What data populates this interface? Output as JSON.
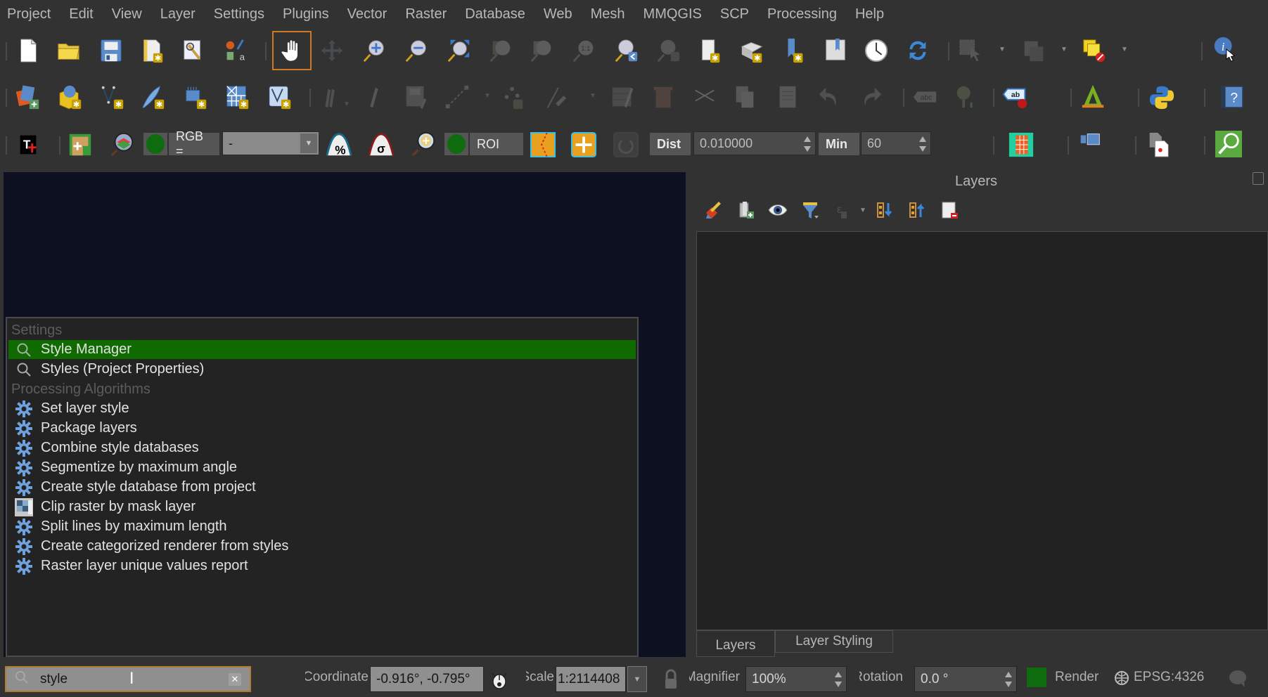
{
  "menubar": {
    "items": [
      "Project",
      "Edit",
      "View",
      "Layer",
      "Settings",
      "Plugins",
      "Vector",
      "Raster",
      "Database",
      "Web",
      "Mesh",
      "MMQGIS",
      "SCP",
      "Processing",
      "Help"
    ]
  },
  "toolbars": {
    "row1": [
      "new-project",
      "open-project",
      "save-project",
      "new-print-layout",
      "style-manager",
      "style-manager-symbols",
      "pan-map",
      "pan-to-selection",
      "zoom-in",
      "zoom-out",
      "zoom-full",
      "zoom-to-selection",
      "zoom-to-layer",
      "zoom-native",
      "zoom-last",
      "zoom-next",
      "new-map-view",
      "new-3d-map-view",
      "new-spatial-bookmark",
      "show-bookmarks",
      "temporal-controller",
      "refresh",
      "select-features",
      "open-attribute-table",
      "deselect-all",
      "identify-features"
    ],
    "row2": [
      "data-source-manager",
      "new-geopackage-layer",
      "new-shapefile-layer",
      "new-temporary-scratch-layer",
      "new-virtual-layer",
      "new-mesh-layer",
      "new-gpx-layer",
      "current-edits",
      "toggle-editing",
      "save-layer-edits",
      "digitize",
      "add-ring",
      "vertex-tool",
      "modify-attributes",
      "delete-selected",
      "cut-features",
      "copy-features",
      "paste-features",
      "undo",
      "redo",
      "label-toolbar",
      "diagram",
      "label-tool",
      "georeferencer",
      "python-console",
      "help"
    ]
  },
  "scp_toolbar": {
    "rgb_label": "RGB =",
    "rgb_value": "-",
    "roi_label": "ROI",
    "dist_label": "Dist",
    "dist_value": "0.010000",
    "min_label": "Min",
    "min_value": "60"
  },
  "locator": {
    "groups": [
      {
        "title": "Settings",
        "items": [
          {
            "label": "Style Manager",
            "icon": "search-icon",
            "selected": true
          },
          {
            "label": "Styles (Project Properties)",
            "icon": "search-icon",
            "selected": false
          }
        ]
      },
      {
        "title": "Processing Algorithms",
        "items": [
          {
            "label": "Set layer style",
            "icon": "gear-icon"
          },
          {
            "label": "Package layers",
            "icon": "gear-icon"
          },
          {
            "label": "Combine style databases",
            "icon": "gear-icon"
          },
          {
            "label": "Segmentize by maximum angle",
            "icon": "gear-icon"
          },
          {
            "label": "Create style database from project",
            "icon": "gear-icon"
          },
          {
            "label": "Clip raster by mask layer",
            "icon": "raster-clip-icon"
          },
          {
            "label": "Split lines by maximum length",
            "icon": "gear-icon"
          },
          {
            "label": "Create categorized renderer from styles",
            "icon": "gear-icon"
          },
          {
            "label": "Raster layer unique values report",
            "icon": "gear-icon"
          }
        ]
      }
    ],
    "selected_color": "#0f6b00"
  },
  "layers_panel": {
    "title": "Layers",
    "tabs": [
      "Layers",
      "Layer Styling"
    ],
    "active_tab": "Layers"
  },
  "statusbar": {
    "search_value": "style",
    "coordinate_label": "Coordinate",
    "coordinate_value": "-0.916°, -0.795°",
    "scale_label": "Scale",
    "scale_value": "1:2114408",
    "magnifier_label": "Magnifier",
    "magnifier_value": "100%",
    "rotation_label": "Rotation",
    "rotation_value": "0.0 °",
    "render_label": "Render",
    "render_checked": true,
    "crs_value": "EPSG:4326"
  }
}
